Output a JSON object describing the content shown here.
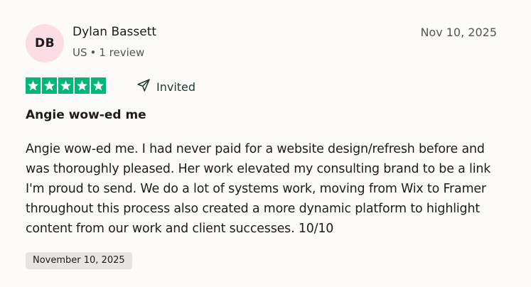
{
  "reviewer": {
    "initials": "DB",
    "name": "Dylan Bassett",
    "country": "US",
    "separator": "•",
    "review_count": "1 review",
    "avatar_color": "#fbdde6"
  },
  "review": {
    "date_top": "Nov 10, 2025",
    "rating": 5,
    "rating_max": 5,
    "star_color": "#00b67a",
    "invited_label": "Invited",
    "invited_icon": "send-icon",
    "title": "Angie wow-ed me",
    "body": "Angie wow-ed me. I had never paid for a website design/refresh before and was thoroughly pleased. Her work elevated my consulting brand to be a link I'm proud to send. We do a lot of systems work, moving from Wix to Framer throughout this process also created a more dynamic platform to highlight content from our work and client successes. 10/10",
    "experience_date": "November 10, 2025"
  }
}
